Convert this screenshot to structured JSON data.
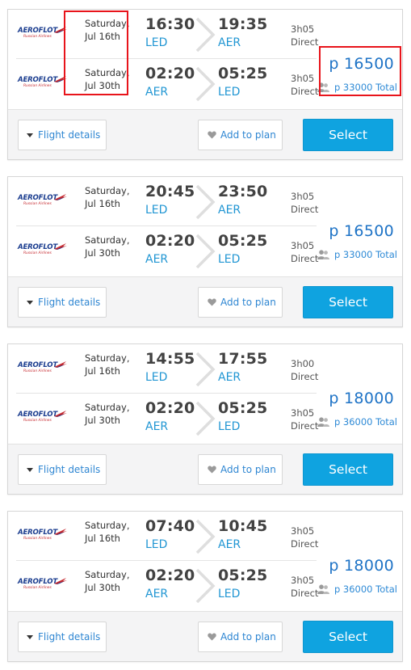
{
  "colors": {
    "accent_blue": "#2196d3",
    "select_button": "#0fa3e0",
    "price_blue": "#1e73c6",
    "highlight_red": "#e8141b",
    "footer_bg": "#f4f4f5"
  },
  "airline": {
    "logo_text": "AEROFLOT",
    "logo_subtext": "Russian Airlines"
  },
  "labels": {
    "flight_details": "Flight details",
    "add_to_plan": "Add to plan",
    "select": "Select"
  },
  "icons": {
    "details_caret": "caret-down-icon",
    "plan": "heart-icon",
    "passengers": "people-icon",
    "arrow": "chevron-right-icon"
  },
  "results": [
    {
      "outbound": {
        "day": "Saturday,",
        "date": "Jul 16th",
        "dep_time": "16:30",
        "dep_code": "LED",
        "arr_time": "19:35",
        "arr_code": "AER",
        "duration": "3h05",
        "stops": "Direct"
      },
      "inbound": {
        "day": "Saturday,",
        "date": "Jul 30th",
        "dep_time": "02:20",
        "dep_code": "AER",
        "arr_time": "05:25",
        "arr_code": "LED",
        "duration": "3h05",
        "stops": "Direct"
      },
      "price": "p 16500",
      "total": "p 33000 Total"
    },
    {
      "outbound": {
        "day": "Saturday,",
        "date": "Jul 16th",
        "dep_time": "20:45",
        "dep_code": "LED",
        "arr_time": "23:50",
        "arr_code": "AER",
        "duration": "3h05",
        "stops": "Direct"
      },
      "inbound": {
        "day": "Saturday,",
        "date": "Jul 30th",
        "dep_time": "02:20",
        "dep_code": "AER",
        "arr_time": "05:25",
        "arr_code": "LED",
        "duration": "3h05",
        "stops": "Direct"
      },
      "price": "p 16500",
      "total": "p 33000 Total"
    },
    {
      "outbound": {
        "day": "Saturday,",
        "date": "Jul 16th",
        "dep_time": "14:55",
        "dep_code": "LED",
        "arr_time": "17:55",
        "arr_code": "AER",
        "duration": "3h00",
        "stops": "Direct"
      },
      "inbound": {
        "day": "Saturday,",
        "date": "Jul 30th",
        "dep_time": "02:20",
        "dep_code": "AER",
        "arr_time": "05:25",
        "arr_code": "LED",
        "duration": "3h05",
        "stops": "Direct"
      },
      "price": "p 18000",
      "total": "p 36000 Total"
    },
    {
      "outbound": {
        "day": "Saturday,",
        "date": "Jul 16th",
        "dep_time": "07:40",
        "dep_code": "LED",
        "arr_time": "10:45",
        "arr_code": "AER",
        "duration": "3h05",
        "stops": "Direct"
      },
      "inbound": {
        "day": "Saturday,",
        "date": "Jul 30th",
        "dep_time": "02:20",
        "dep_code": "AER",
        "arr_time": "05:25",
        "arr_code": "LED",
        "duration": "3h05",
        "stops": "Direct"
      },
      "price": "p 18000",
      "total": "p 36000 Total"
    }
  ]
}
